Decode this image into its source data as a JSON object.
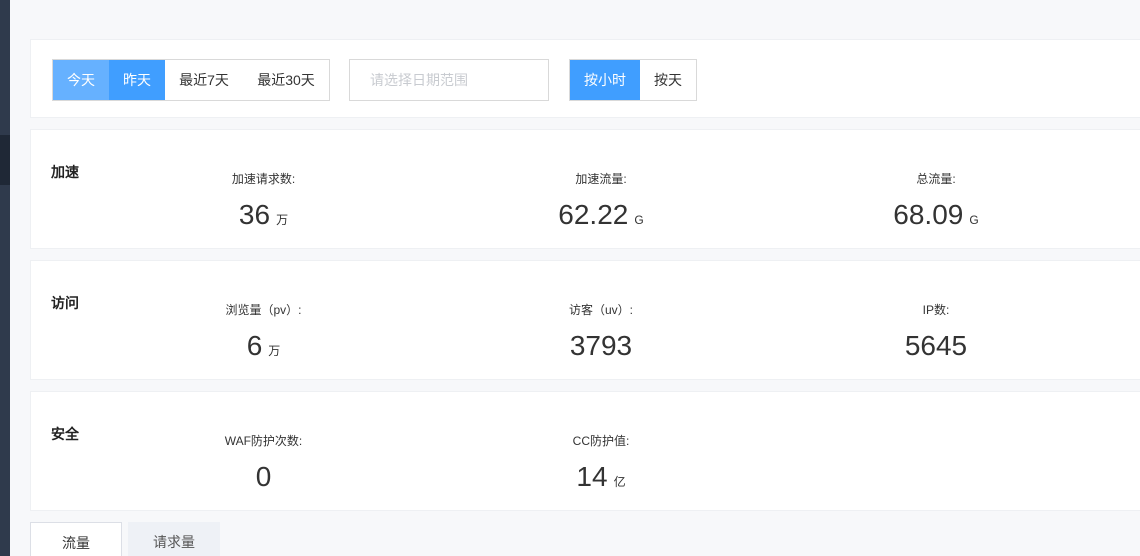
{
  "toolbar": {
    "range_buttons": [
      "今天",
      "昨天",
      "最近7天",
      "最近30天"
    ],
    "date_placeholder": "请选择日期范围",
    "granularity_buttons": [
      "按小时",
      "按天"
    ]
  },
  "sections": {
    "accel": {
      "label": "加速",
      "metrics": [
        {
          "label": "加速请求数:",
          "value": "36",
          "unit": "万"
        },
        {
          "label": "加速流量:",
          "value": "62.22",
          "unit": "G"
        },
        {
          "label": "总流量:",
          "value": "68.09",
          "unit": "G"
        }
      ]
    },
    "visit": {
      "label": "访问",
      "metrics": [
        {
          "label": "浏览量（pv）:",
          "value": "6",
          "unit": "万"
        },
        {
          "label": "访客（uv）:",
          "value": "3793",
          "unit": ""
        },
        {
          "label": "IP数:",
          "value": "5645",
          "unit": ""
        }
      ]
    },
    "security": {
      "label": "安全",
      "metrics": [
        {
          "label": "WAF防护次数:",
          "value": "0",
          "unit": ""
        },
        {
          "label": "CC防护值:",
          "value": "14",
          "unit": "亿"
        }
      ]
    }
  },
  "tabs": [
    "流量",
    "请求量"
  ],
  "colors": {
    "primary": "#409eff",
    "primary_light": "#66b1ff",
    "sidebar": "#2f3a4c"
  }
}
